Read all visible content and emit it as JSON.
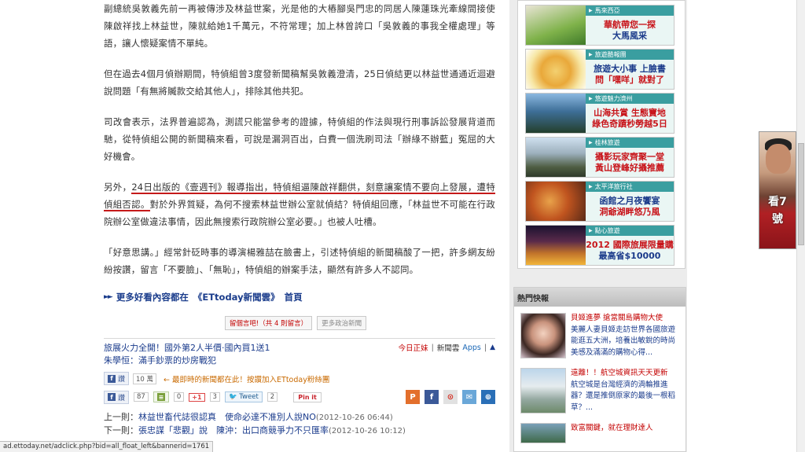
{
  "article": {
    "p1": "副總統吳敦義先前一再被傳涉及林益世案，光是他的大樁腳吳門忠的同居人陳蓮珠光牽線間接使陳啟祥找上林益世，陳就給她1千萬元，不符常理；加上林曾誇口「吳敦義的事我全權處理」等語，讓人懷疑案情不單純。",
    "p2": "但在過去4個月偵辦期間，特偵組曾3度發新聞稿幫吳敦義澄清，25日偵結更以林益世通通近迴避說問題「有無將贓款交給其他人」，排除其他共犯。",
    "p3": "司改會表示，法界普遍認為，測謊只能當參考的證據，特偵組的作法與現行刑事訴訟發展背道而馳，從特偵組公開的新聞稿來看，可說是漏洞百出，白費一個洗刷司法「辦綠不辦藍」冤屈的大好機會。",
    "p4a": "另外，",
    "p4b": "24日出版的《壹週刊》報導指出，特偵組逼陳啟祥翻供，刻意讓案情不要向上發展，",
    "p4c": "遭特偵組否認。",
    "p4d": "對於外界質疑，為何不搜索林益世辦公室就偵結？特偵組回應，「林益世不可能在行政院辦公室做違法事情，因此無搜索行政院辦公室必要。」也被人吐槽。",
    "p5": "「好意思講。」經常針砭時事的導演楊雅喆在臉書上，引述特偵組的新聞稿酸了一把，許多網友紛紛按讚，留言「不要臉」、「無恥」，特偵組的辦案手法，顯然有許多人不認同。",
    "more_prefix": "更多好看內容都在",
    "more_link": "《ETtoday新聞雲》",
    "more_suffix": "首頁"
  },
  "comments": {
    "leave_label": "留個言吧!（共 4 則留言）",
    "more_politics": "更多政治新聞"
  },
  "promo": {
    "line1": "旅展火力全開！國外第2人半價‧國內買1送1",
    "line2": "朱學恒：滿手鈔票的炒房戰犯",
    "today": "今日正妹",
    "cloud": "新聞雲",
    "apps": "Apps"
  },
  "share": {
    "like_label": "讚",
    "like_count": "10 萬",
    "recommend": "← 最即時的新聞都在此！按讚加入ETtoday粉絲團",
    "like2_count": "87",
    "share_count": "0",
    "gplus_label": "+1",
    "gplus_count": "3",
    "tweet_label": "Tweet",
    "tweet_count": "2",
    "pinit_label": "Pin it"
  },
  "prevnext": {
    "prev_label": "上一則：",
    "prev_title": "林益世畜代誌很認真　使命必達不准別人說NO",
    "prev_date": "(2012-10-26 06:44)",
    "next_label": "下一則：",
    "next_title": "張忠謀「悲觀」說　陳沖：出口商競爭力不只匯率",
    "next_date": "(2012-10-26 10:12)"
  },
  "status_url": "ad.ettoday.net/adclick.php?bid=all_float_left&bannerid=1761",
  "ads": [
    {
      "tag": "馬來西亞",
      "a": "華航帶您一探",
      "b": "大馬風采"
    },
    {
      "tag": "旅遊酷報團",
      "a": "旅遊大小事 上臉書",
      "b": "問「嘿咩」就對了"
    },
    {
      "tag": "悠遊魅力濟州",
      "a": "山海共賞 生態寶地",
      "b": "綠色奇蹟秒勞越5日"
    },
    {
      "tag": "桂林旅遊",
      "a": "攝影玩家齊聚一堂",
      "b": "黃山登峰好攝推薦"
    },
    {
      "tag": "太平洋旅行社",
      "a": "函館之月夜饗宴",
      "b": "洞爺湖畔悠乃風"
    },
    {
      "tag": "點心旅遊",
      "a": "2012 國際旅展限量購",
      "b": "最高省$10000"
    }
  ],
  "hot": {
    "header": "熱門快報",
    "items": [
      {
        "title": "貝姬進夢 搶當關島購物大使",
        "body": "美麗人妻貝姬走訪世界各國旅遊能逛五大洲，培養出敏銳的時尚美感及滿滿的購物心得..."
      },
      {
        "title": "遠離！！航空城資訊天天更新",
        "body": "航空城是台灣經濟的渦輪推進器？還是推倒原家的最後一根稻草？..."
      },
      {
        "title": "致富關鍵，就在理財達人",
        "body": ""
      }
    ]
  },
  "side": {
    "label": "看7號"
  },
  "colors": {
    "accent_red": "#c51a1a",
    "link_blue": "#1a3b8c",
    "ad_tag": "#3a9ea0"
  }
}
